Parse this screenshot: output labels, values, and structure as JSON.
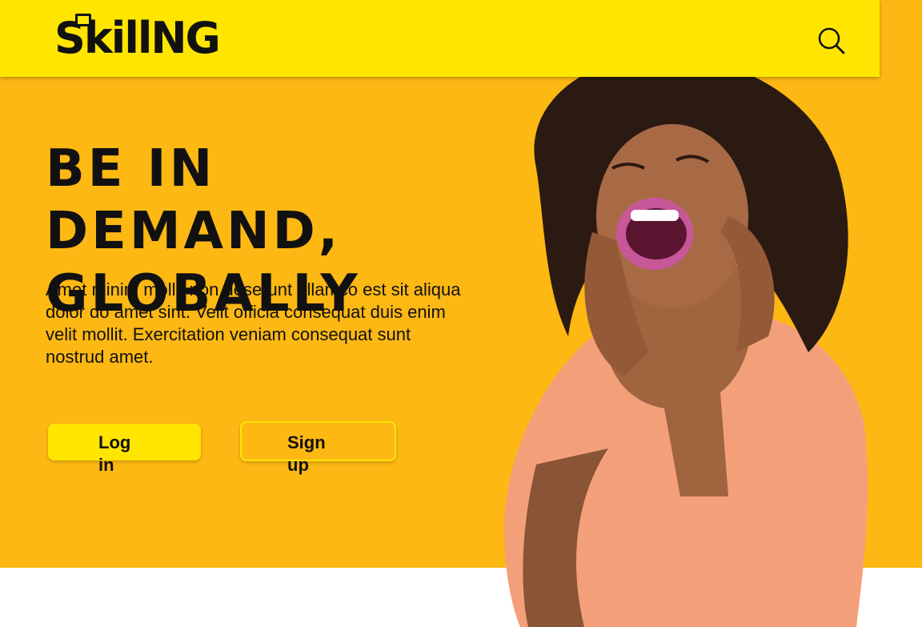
{
  "brand": {
    "logo_text": "SkillNG"
  },
  "hero": {
    "headline": "BE IN DEMAND, GLOBALLY",
    "body": "Amet minim mollit non deserunt ullamco est sit aliqua dolor do amet sint. Velit officia consequat duis enim velit mollit. Exercitation veniam consequat sunt nostrud amet."
  },
  "buttons": {
    "login_label": "Log in",
    "signup_label": "Sign up"
  },
  "icons": {
    "search": "search-icon"
  },
  "colors": {
    "header_bg": "#ffe500",
    "hero_bg": "#fdb813",
    "text": "#111111",
    "page_bg": "#ffffff"
  }
}
